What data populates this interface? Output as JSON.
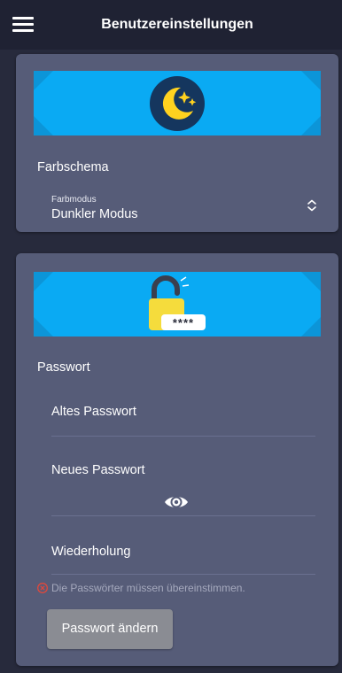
{
  "header": {
    "title": "Benutzereinstellungen",
    "menu_icon": "hamburger-menu-icon"
  },
  "color_scheme": {
    "banner_icon": "moon-stars-icon",
    "section_label": "Farbschema",
    "select": {
      "caption": "Farbmodus",
      "value": "Dunkler Modus",
      "icon": "chevron-updown-icon"
    }
  },
  "password": {
    "banner_icon": "padlock-password-icon",
    "banner_mask": "****",
    "section_label": "Passwort",
    "old_password_label": "Altes Passwort",
    "new_password_label": "Neues Passwort",
    "toggle_visibility_icon": "eye-icon",
    "repeat_label": "Wiederholung",
    "error_icon": "error-circle-icon",
    "error_message": "Die Passwörter müssen übereinstimmen.",
    "submit_label": "Passwort ändern"
  },
  "colors": {
    "background": "#272a3c",
    "appbar": "#1f2233",
    "card": "#565c78",
    "banner": "#0aaaf3",
    "moon": "#ffd21f",
    "button_disabled": "#8a8c93",
    "error": "#e0483c"
  }
}
